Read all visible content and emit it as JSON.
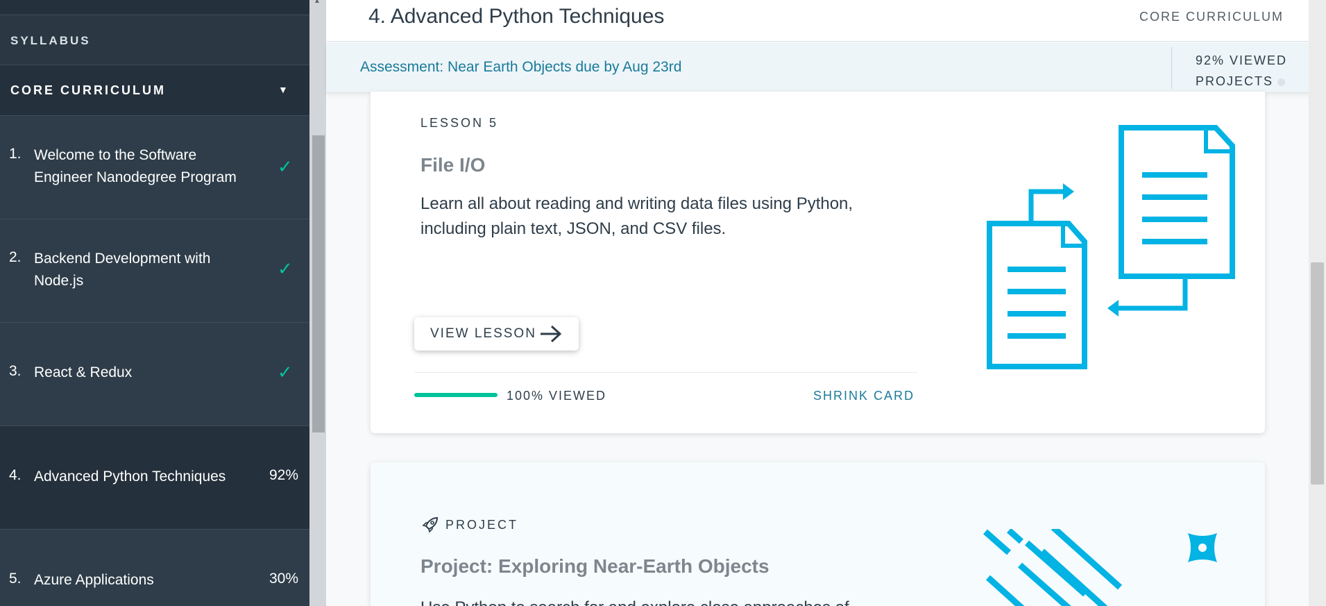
{
  "sidebar": {
    "syllabus_label": "SYLLABUS",
    "curriculum_label": "CORE CURRICULUM",
    "items": [
      {
        "num": "1.",
        "label": "Welcome to the Software Engineer Nanodegree Program",
        "status": "complete"
      },
      {
        "num": "2.",
        "label": "Backend Development with Node.js",
        "status": "complete"
      },
      {
        "num": "3.",
        "label": "React & Redux",
        "status": "complete"
      },
      {
        "num": "4.",
        "label": "Advanced Python Techniques",
        "status": "92%"
      },
      {
        "num": "5.",
        "label": "Azure Applications",
        "status": "30%"
      }
    ]
  },
  "header": {
    "title": "4. Advanced Python Techniques",
    "tag": "CORE CURRICULUM"
  },
  "subheader": {
    "assessment": "Assessment: Near Earth Objects due by Aug 23rd",
    "viewed": "92% VIEWED",
    "projects": "PROJECTS"
  },
  "lesson_card": {
    "eyebrow": "LESSON 5",
    "title": "File I/O",
    "description": "Learn all about reading and writing data files using Python, including plain text, JSON, and CSV files.",
    "button_label": "VIEW LESSON",
    "progress_fraction": 1.0,
    "progress_label": "100% VIEWED",
    "shrink_label": "SHRINK CARD"
  },
  "project_card": {
    "eyebrow": "PROJECT",
    "title": "Project: Exploring Near-Earth Objects",
    "description": "Use Python to search for and explore close approaches of"
  },
  "colors": {
    "accent_blue": "#02b3e4",
    "success_green": "#02c39a",
    "sidebar_bg": "#2e3d49",
    "link_teal": "#1a7a9a"
  },
  "icons": {
    "check": "check-icon",
    "chevron": "chevron-down-icon",
    "arrow": "arrow-right-icon",
    "rocket": "rocket-icon"
  }
}
